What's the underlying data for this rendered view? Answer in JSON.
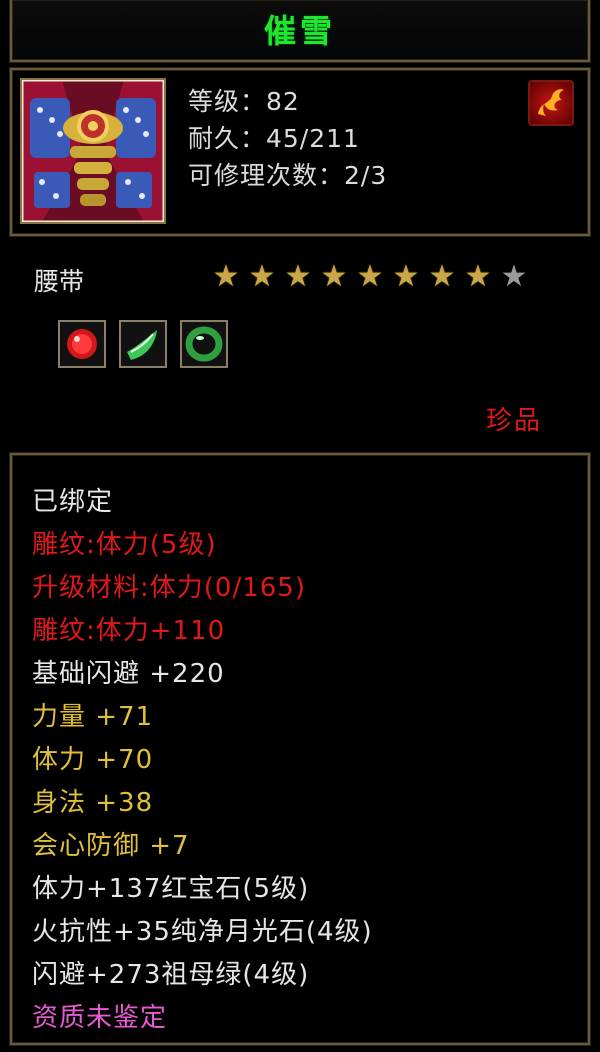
{
  "item": {
    "name": "催雪",
    "level": "等级：82",
    "durability": "耐久：45/211",
    "repair": "可修理次数：2/3",
    "type": "腰带",
    "rarity": "珍品",
    "stars": {
      "total": 9,
      "lit": 8
    },
    "gems": [
      "red-ruby-gem-icon",
      "moonstone-gem-icon",
      "emerald-ring-gem-icon"
    ],
    "colors": {
      "name": "#1ee82a",
      "red": "#e01818",
      "gold": "#dfc038",
      "white": "#e6e6e6",
      "pink": "#e65ad2"
    }
  },
  "attributes": [
    {
      "text": "已绑定",
      "color": "white"
    },
    {
      "text": "雕纹:体力(5级)",
      "color": "red"
    },
    {
      "text": "升级材料:体力(0/165)",
      "color": "red"
    },
    {
      "text": "雕纹:体力+110",
      "color": "red"
    },
    {
      "text": "基础闪避 +220",
      "color": "white"
    },
    {
      "text": "力量 +71",
      "color": "gold"
    },
    {
      "text": "体力 +70",
      "color": "gold"
    },
    {
      "text": "身法 +38",
      "color": "gold"
    },
    {
      "text": "会心防御 +7",
      "color": "gold"
    },
    {
      "text": "体力+137红宝石(5级)",
      "color": "white"
    },
    {
      "text": "火抗性+35纯净月光石(4级)",
      "color": "white"
    },
    {
      "text": "闪避+273祖母绿(4级)",
      "color": "white"
    },
    {
      "text": "资质未鉴定",
      "color": "pink"
    }
  ]
}
